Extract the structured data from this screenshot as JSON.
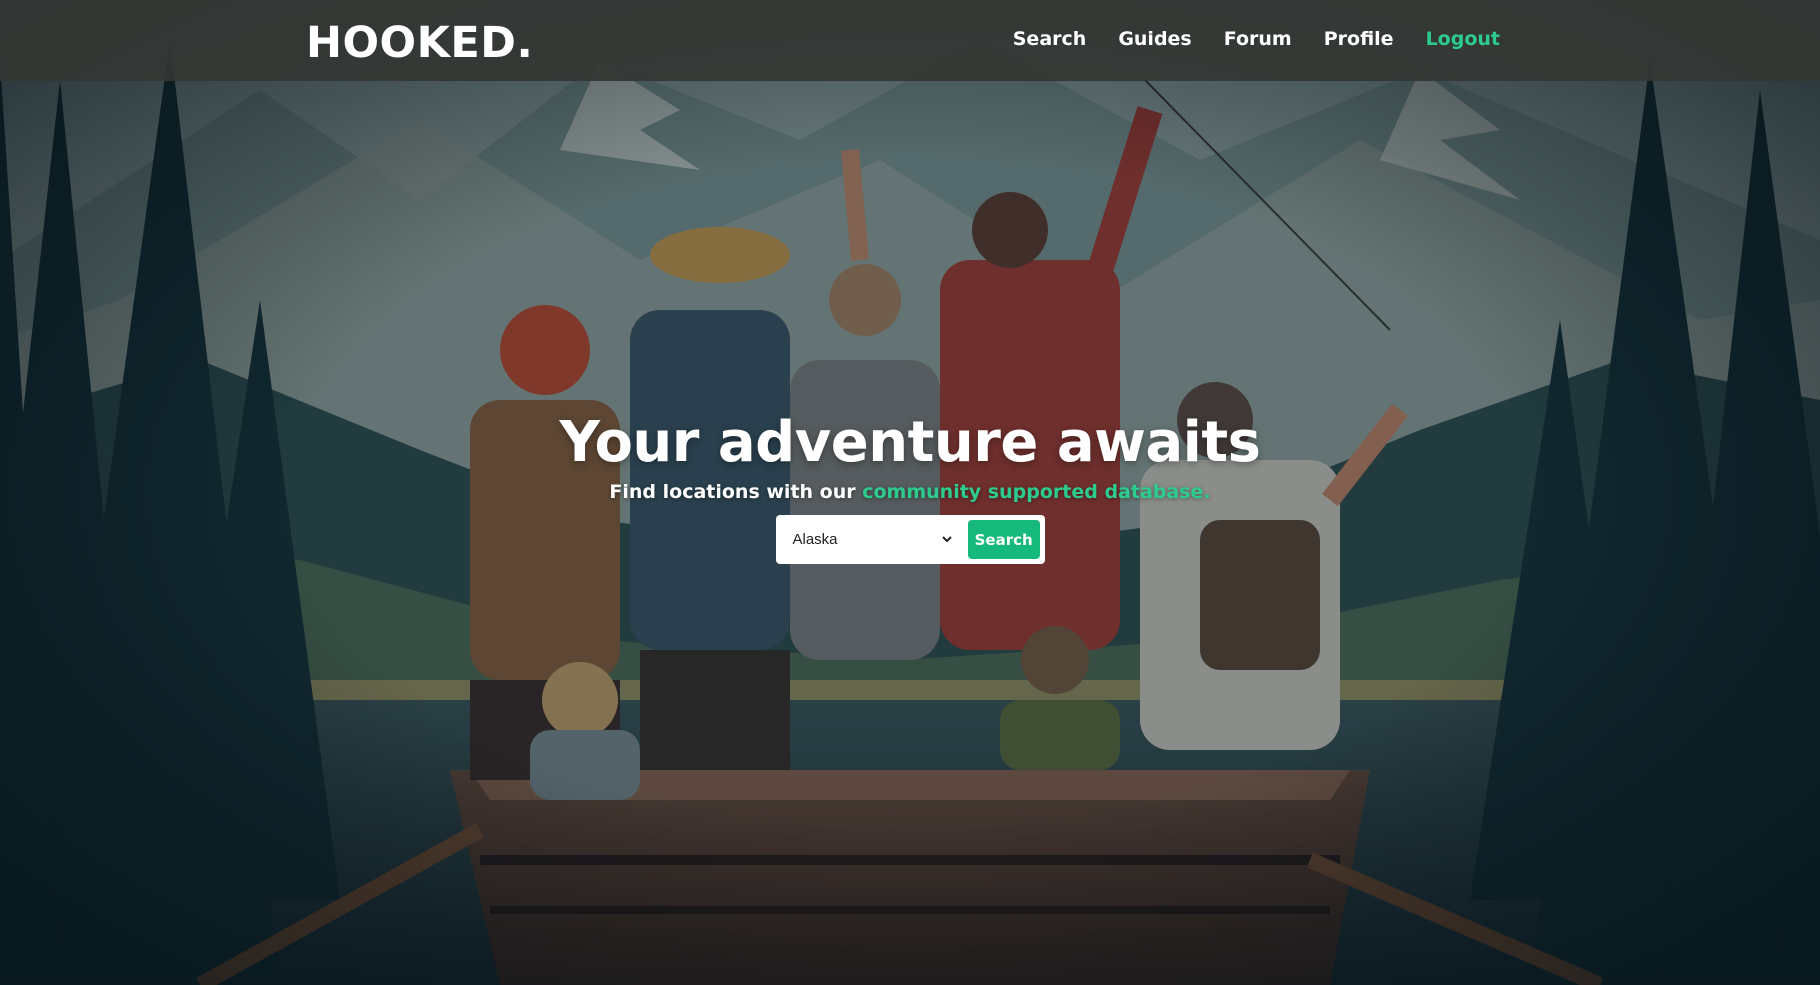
{
  "navbar": {
    "brand": "HOOKED.",
    "links": [
      {
        "label": "Search"
      },
      {
        "label": "Guides"
      },
      {
        "label": "Forum"
      },
      {
        "label": "Profile"
      },
      {
        "label": "Logout"
      }
    ]
  },
  "hero": {
    "title": "Your adventure awaits",
    "subtitle_prefix": "Find locations with our ",
    "subtitle_link": "community supported database.",
    "search": {
      "selected_location": "Alaska",
      "button_label": "Search"
    }
  },
  "colors": {
    "accent": "#2ccc8f",
    "button": "#16b97c",
    "navbar": "#343734"
  },
  "icons": {
    "dropdown": "chevron-down-icon"
  }
}
